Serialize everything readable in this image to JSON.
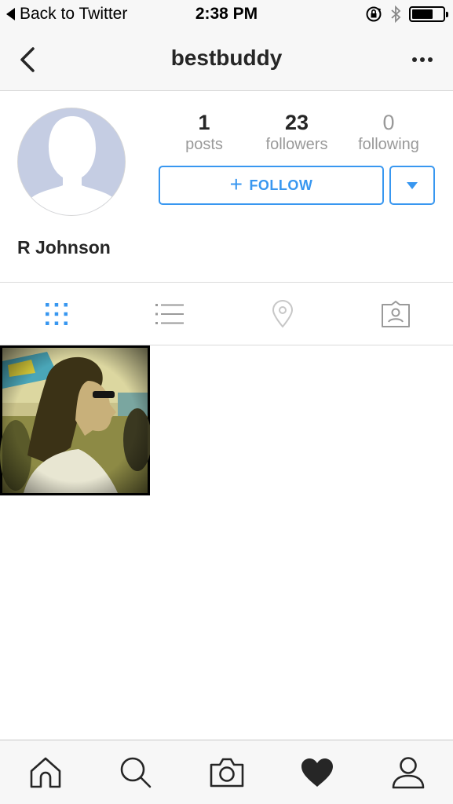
{
  "status_bar": {
    "back_app": "Back to Twitter",
    "time": "2:38 PM",
    "icons": [
      "orientation-lock-icon",
      "bluetooth-icon",
      "battery-icon"
    ]
  },
  "nav": {
    "title": "bestbuddy",
    "back_icon": "chevron-left-icon",
    "more_icon": "more-dots-icon"
  },
  "profile": {
    "avatar": "default-avatar",
    "full_name": "R Johnson",
    "stats": {
      "posts": {
        "value": "1",
        "label": "posts"
      },
      "followers": {
        "value": "23",
        "label": "followers"
      },
      "following": {
        "value": "0",
        "label": "following"
      }
    },
    "follow_button": {
      "plus": "+",
      "label": "FOLLOW"
    },
    "dropdown_icon": "triangle-down-icon"
  },
  "tabs": [
    {
      "name": "grid",
      "icon": "grid-icon",
      "active": true
    },
    {
      "name": "list",
      "icon": "list-icon",
      "active": false
    },
    {
      "name": "location",
      "icon": "location-pin-icon",
      "active": false
    },
    {
      "name": "tagged",
      "icon": "tagged-user-icon",
      "active": false
    }
  ],
  "posts": [
    {
      "description_icon": "photo-thumbnail"
    }
  ],
  "bottom_tabs": [
    {
      "name": "home",
      "icon": "home-icon"
    },
    {
      "name": "search",
      "icon": "search-icon"
    },
    {
      "name": "camera",
      "icon": "camera-icon"
    },
    {
      "name": "activity",
      "icon": "heart-icon",
      "active": true
    },
    {
      "name": "profile",
      "icon": "user-icon"
    }
  ],
  "colors": {
    "accent": "#3897f0",
    "text": "#262626",
    "muted": "#999999",
    "bar_bg": "#f7f7f7"
  }
}
